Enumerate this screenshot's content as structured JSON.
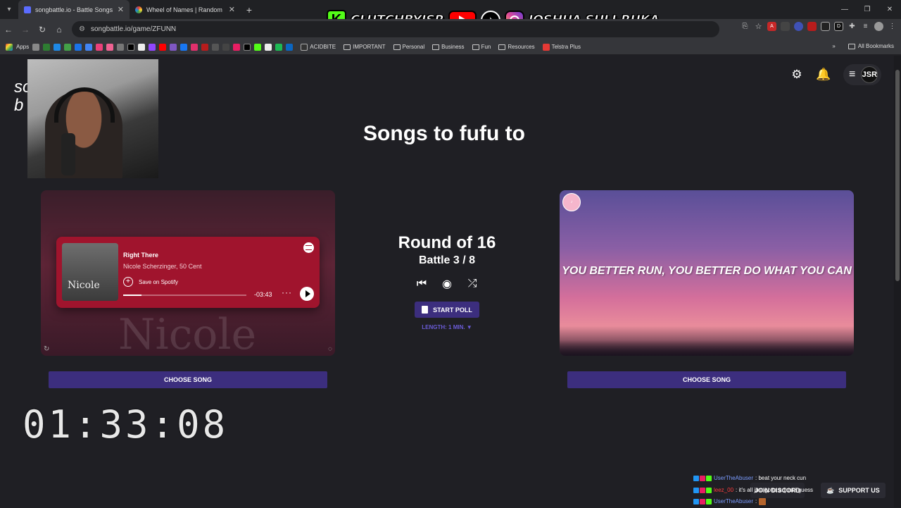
{
  "browser": {
    "tabs": [
      {
        "title": "songbattle.io - Battle Songs ag",
        "active": true
      },
      {
        "title": "Wheel of Names | Random nam",
        "active": false
      }
    ],
    "url": "songbattle.io/game/ZFUNN",
    "bookmarks": {
      "apps_label": "Apps",
      "folders": [
        "ACIDBITE",
        "IMPORTANT",
        "Personal",
        "Business",
        "Fun",
        "Resources",
        "Telstra Plus"
      ],
      "all_bookmarks": "All Bookmarks"
    }
  },
  "overlay": {
    "kick_handle": "CLUTCHBYJSR",
    "name": "JOSHUA SULI-RUKA",
    "timer": "01:33:08"
  },
  "header": {
    "logo_fragment_1": "so",
    "logo_fragment_2": "b",
    "avatar_text": "JSR"
  },
  "game": {
    "title": "Songs to fufu to",
    "round": "Round of 16",
    "battle": "Battle 3 / 8",
    "start_poll": "START POLL",
    "length": "LENGTH: 1 MIN. ▼",
    "left": {
      "song_title": "Right There",
      "artist": "Nicole Scherzinger, 50 Cent",
      "save_label": "Save on Spotify",
      "time_remaining": "-03:43",
      "progress": 0.15,
      "choose_label": "CHOOSE SONG"
    },
    "right": {
      "lyric": "YOU BETTER RUN, YOU BETTER DO WHAT YOU CAN",
      "choose_label": "CHOOSE SONG"
    }
  },
  "chat": {
    "messages": [
      {
        "user": "UserTheAbuser",
        "text": ": beat your neck cun"
      },
      {
        "user": "leez_00",
        "text": ": it's all just gotta adjust i guess"
      },
      {
        "user": "UserTheAbuser",
        "text": ":"
      }
    ],
    "support_label": "SUPPORT US",
    "follow_label": "JOIN DISCORD"
  },
  "colors": {
    "page_bg": "#1f1f24",
    "accent_purple": "#3c2e7e",
    "spotify_red": "#a0142d"
  }
}
